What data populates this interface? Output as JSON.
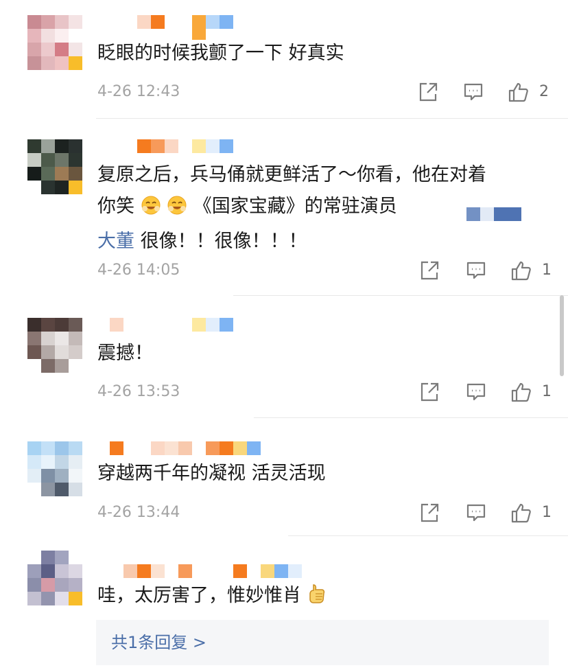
{
  "comments": [
    {
      "text": "眨眼的时候我颤了一下  好真实",
      "time": "4-26 12:43",
      "likes": "2",
      "icons": [
        "share-icon",
        "comment-icon",
        "like-icon"
      ]
    },
    {
      "text_line1": "复原之后，兵马俑就更鲜活了～你看，他在对着",
      "text_line2_a": "你笑",
      "text_line2_b": "《国家宝藏》的常驻演员",
      "mention": "大董",
      "text_line3": "很像！！很像！！！",
      "time": "4-26 14:05",
      "likes": "1"
    },
    {
      "text": "震撼！",
      "time": "4-26 13:53",
      "likes": "1"
    },
    {
      "text": "穿越两千年的凝视 活灵活现",
      "time": "4-26 13:44",
      "likes": "1"
    },
    {
      "text": "哇，太厉害了，惟妙惟肖"
    }
  ],
  "reply_link": "共1条回复 >",
  "colors": {
    "link": "#4a6ea8",
    "meta": "#a3a3a3",
    "divider": "#e8e8e8",
    "reply_bg": "#f5f6f8"
  }
}
